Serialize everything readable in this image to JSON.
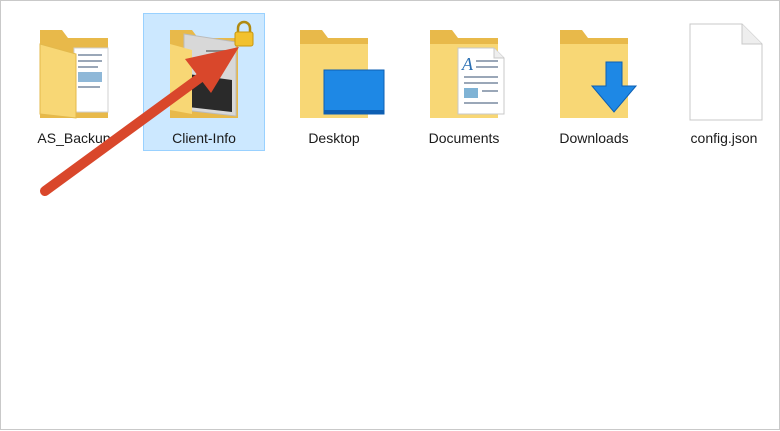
{
  "files": [
    {
      "name": "AS_Backup",
      "icon": "folder-with-documents-icon",
      "selected": false
    },
    {
      "name": "Client-Info",
      "icon": "encrypted-folder-icon",
      "selected": true
    },
    {
      "name": "Desktop",
      "icon": "desktop-folder-icon",
      "selected": false
    },
    {
      "name": "Documents",
      "icon": "documents-folder-icon",
      "selected": false
    },
    {
      "name": "Downloads",
      "icon": "downloads-folder-icon",
      "selected": false
    },
    {
      "name": "config.json",
      "icon": "json-file-icon",
      "selected": false
    }
  ],
  "colors": {
    "selection_bg": "#cce8ff",
    "selection_border": "#99d1ff",
    "folder": "#f8d775",
    "annotation_arrow": "#d9472b"
  },
  "annotation": {
    "type": "arrow",
    "target": "Client-Info"
  }
}
